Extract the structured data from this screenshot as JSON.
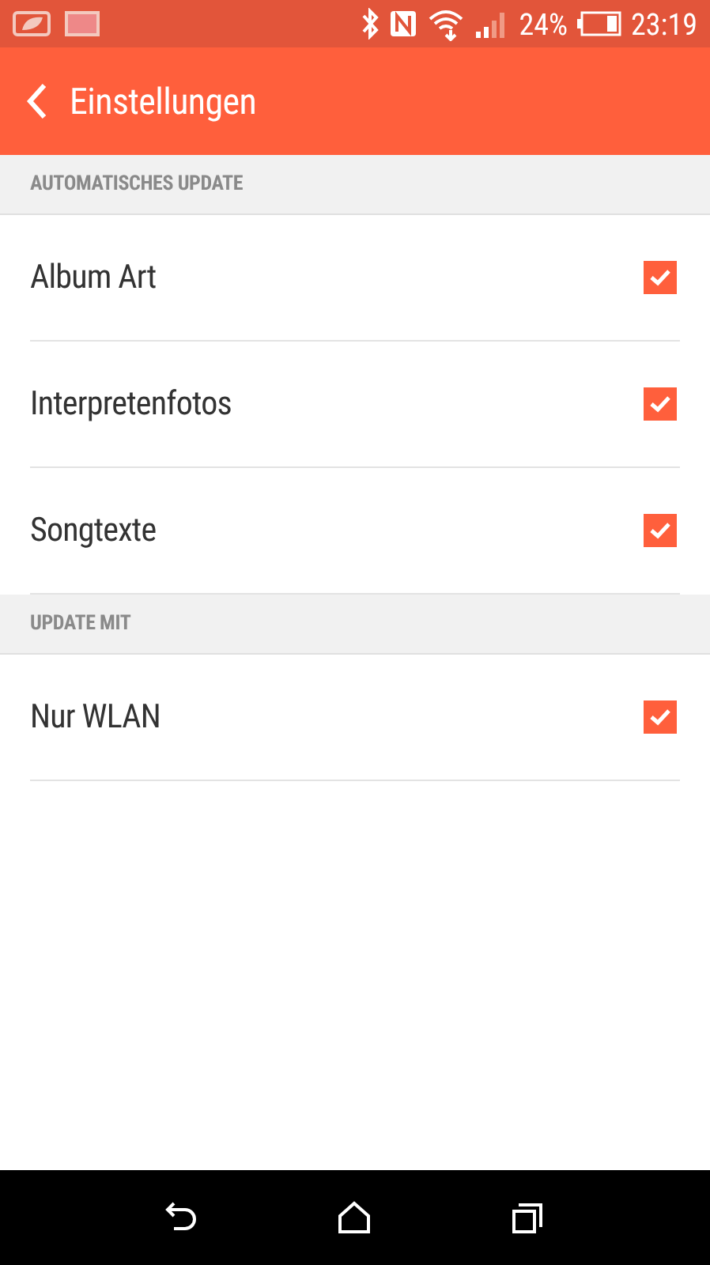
{
  "status_bar": {
    "battery": "24%",
    "time": "23:19"
  },
  "app_bar": {
    "title": "Einstellungen"
  },
  "sections": [
    {
      "header": "AUTOMATISCHES UPDATE",
      "items": [
        {
          "label": "Album Art",
          "checked": true
        },
        {
          "label": "Interpretenfotos",
          "checked": true
        },
        {
          "label": "Songtexte",
          "checked": true
        }
      ]
    },
    {
      "header": "UPDATE MIT",
      "items": [
        {
          "label": "Nur WLAN",
          "checked": true
        }
      ]
    }
  ]
}
